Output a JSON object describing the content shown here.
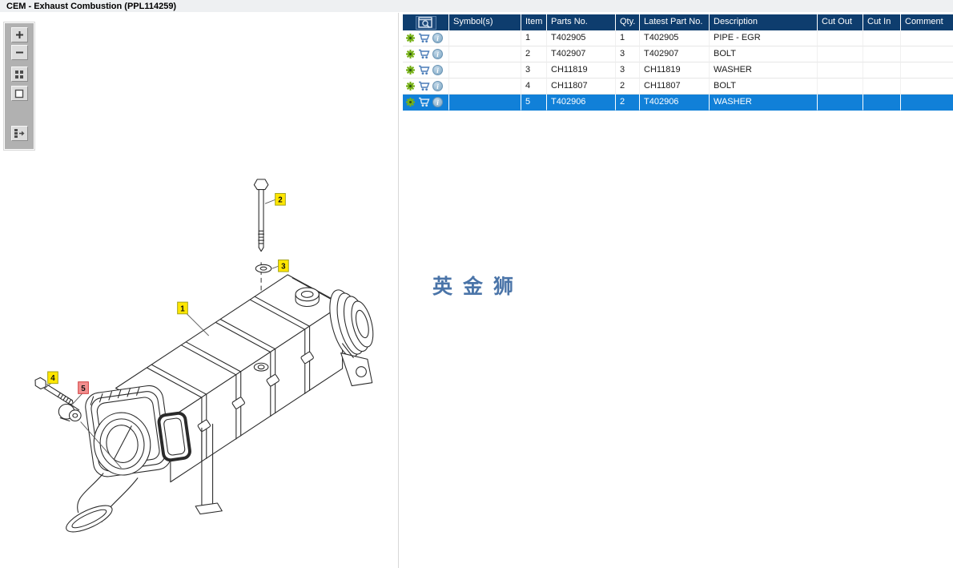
{
  "window": {
    "title": "CEM - Exhaust Combustion (PPL114259)"
  },
  "toolbar": {
    "buttons": [
      {
        "name": "zoom-in"
      },
      {
        "name": "zoom-out"
      },
      {
        "name": "tile-view"
      },
      {
        "name": "actual-size"
      },
      {
        "name": "toggle-parts-panel"
      }
    ]
  },
  "diagram": {
    "callouts": [
      {
        "label": "1",
        "highlighted": false
      },
      {
        "label": "2",
        "highlighted": false
      },
      {
        "label": "3",
        "highlighted": false
      },
      {
        "label": "4",
        "highlighted": false
      },
      {
        "label": "5",
        "highlighted": true
      }
    ],
    "callout_colors": {
      "normal_bg": "#ffe600",
      "normal_border": "#a3a31a",
      "highlight_bg": "#f28f8f",
      "highlight_border": "#d03a3a"
    }
  },
  "watermark": {
    "text": "英金狮",
    "color": "#4a74a8"
  },
  "icons": {
    "info_glyph": "i"
  },
  "table": {
    "columns": [
      "",
      "Symbol(s)",
      "Item",
      "Parts No.",
      "Qty.",
      "Latest Part No.",
      "Description",
      "Cut Out",
      "Cut In",
      "Comment"
    ],
    "colors": {
      "header_bg": "#0e3d6e",
      "selected_row_bg": "#1180d8"
    },
    "rows": [
      {
        "symbols": "",
        "item": "1",
        "parts_no": "T402905",
        "qty": "1",
        "latest_part_no": "T402905",
        "description": "PIPE - EGR",
        "cut_out": "",
        "cut_in": "",
        "comment": "",
        "selected": false
      },
      {
        "symbols": "",
        "item": "2",
        "parts_no": "T402907",
        "qty": "3",
        "latest_part_no": "T402907",
        "description": "BOLT",
        "cut_out": "",
        "cut_in": "",
        "comment": "",
        "selected": false
      },
      {
        "symbols": "",
        "item": "3",
        "parts_no": "CH11819",
        "qty": "3",
        "latest_part_no": "CH11819",
        "description": "WASHER",
        "cut_out": "",
        "cut_in": "",
        "comment": "",
        "selected": false
      },
      {
        "symbols": "",
        "item": "4",
        "parts_no": "CH11807",
        "qty": "2",
        "latest_part_no": "CH11807",
        "description": "BOLT",
        "cut_out": "",
        "cut_in": "",
        "comment": "",
        "selected": false
      },
      {
        "symbols": "",
        "item": "5",
        "parts_no": "T402906",
        "qty": "2",
        "latest_part_no": "T402906",
        "description": "WASHER",
        "cut_out": "",
        "cut_in": "",
        "comment": "",
        "selected": true
      }
    ]
  }
}
